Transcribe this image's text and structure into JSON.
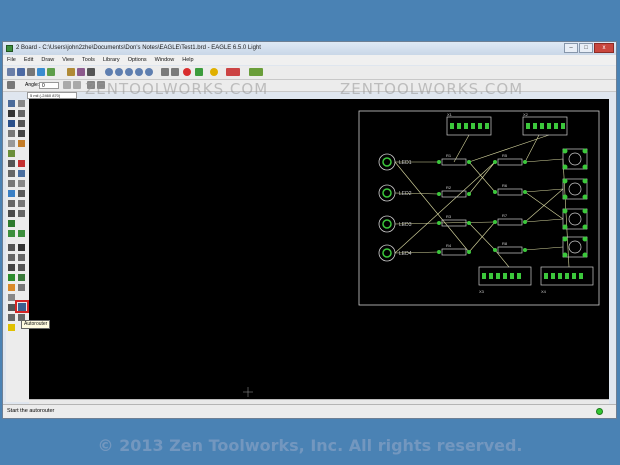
{
  "window": {
    "title": "2 Board - C:\\Users\\john2zhe\\Documents\\Don's Notes\\EAGLE\\Test1.brd - EAGLE 6.5.0 Light",
    "controls": {
      "minimize": "–",
      "maximize": "□",
      "close": "x"
    }
  },
  "menu": {
    "items": [
      "File",
      "Edit",
      "Draw",
      "View",
      "Tools",
      "Library",
      "Options",
      "Window",
      "Help"
    ]
  },
  "toolbar2": {
    "angle_label": "Angle:",
    "angle_value": "0"
  },
  "coord": {
    "value": "5 mil (-2460 870)"
  },
  "tooltip": {
    "text": "Autorouter"
  },
  "status": {
    "text": "Start the autorouter"
  },
  "watermarks": {
    "left": "ZENTOOLWORKS.COM",
    "right": "ZENTOOLWORKS.COM"
  },
  "copyright": "© 2013 Zen Toolworks, Inc. All rights reserved.",
  "board": {
    "leds": [
      "LED1",
      "LED2",
      "LED3",
      "LED4"
    ],
    "resistors": [
      "R1",
      "R2",
      "R3",
      "R4",
      "R5",
      "R6",
      "R7",
      "R8"
    ],
    "connectors": [
      "X1",
      "X2",
      "X3",
      "X4"
    ]
  },
  "colors": {
    "background": "#4a82b4",
    "canvas": "#000000",
    "pad": "#3cc83c",
    "outline": "#cfcfcf",
    "airwire": "#d8d8a0",
    "highlight": "#d42424"
  }
}
